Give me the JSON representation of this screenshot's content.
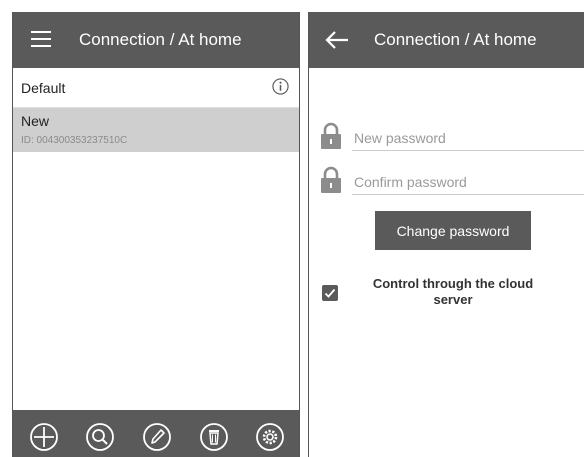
{
  "left_screen": {
    "title": "Connection / At home",
    "list": [
      {
        "label": "Default"
      },
      {
        "label": "New",
        "sub": "ID: 004300353237510C"
      }
    ]
  },
  "right_screen": {
    "title": "Connection / At home",
    "new_password_placeholder": "New password",
    "confirm_password_placeholder": "Confirm password",
    "change_button": "Change password",
    "cloud_label": "Control through the cloud server",
    "cloud_checked": true
  },
  "colors": {
    "appbar": "#5a5a5a",
    "selected_row": "#cfcfcf"
  },
  "icons": [
    "menu-icon",
    "info-icon",
    "add-icon",
    "search-icon",
    "edit-icon",
    "delete-icon",
    "settings-icon",
    "back-arrow-icon",
    "lock-icon",
    "checkmark-icon"
  ]
}
